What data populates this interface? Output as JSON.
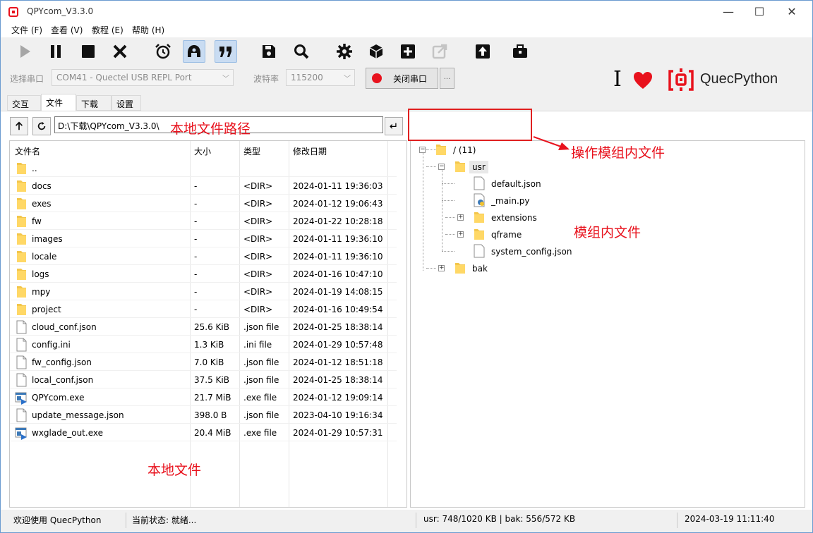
{
  "window": {
    "title": "QPYcom_V3.3.0"
  },
  "menu": [
    "文件 (F)",
    "查看 (V)",
    "教程 (E)",
    "帮助 (H)"
  ],
  "toolbar": {
    "icons": [
      "play-icon",
      "pause-icon",
      "stop-icon",
      "close-x-icon",
      "alarm-clock-icon",
      "rocket-icon",
      "quote-icon",
      "save-icon",
      "search-icon",
      "gear-icon",
      "package-icon",
      "plus-box-icon",
      "export-icon",
      "upload-icon",
      "toolbox-icon"
    ]
  },
  "port": {
    "label": "选择串口",
    "value": "COM41 - Quectel USB REPL Port",
    "baud_label": "波特率",
    "baud_value": "115200",
    "close_label": "关闭串口",
    "more": "..."
  },
  "brand": {
    "name": "QuecPython",
    "cursor": "I"
  },
  "tabs": [
    "交互",
    "文件",
    "下载",
    "设置"
  ],
  "selected_tab": "文件",
  "local": {
    "path": "D:\\下载\\QPYcom_V3.3.0\\",
    "enter": "↵",
    "headers": [
      "文件名",
      "大小",
      "类型",
      "修改日期"
    ],
    "rows": [
      {
        "name": "..",
        "size": "",
        "type": "",
        "date": "",
        "kind": "folder"
      },
      {
        "name": "docs",
        "size": "-",
        "type": "<DIR>",
        "date": "2024-01-11 19:36:03",
        "kind": "folder"
      },
      {
        "name": "exes",
        "size": "-",
        "type": "<DIR>",
        "date": "2024-01-12 19:06:43",
        "kind": "folder"
      },
      {
        "name": "fw",
        "size": "-",
        "type": "<DIR>",
        "date": "2024-01-22 10:28:18",
        "kind": "folder"
      },
      {
        "name": "images",
        "size": "-",
        "type": "<DIR>",
        "date": "2024-01-11 19:36:10",
        "kind": "folder"
      },
      {
        "name": "locale",
        "size": "-",
        "type": "<DIR>",
        "date": "2024-01-11 19:36:10",
        "kind": "folder"
      },
      {
        "name": "logs",
        "size": "-",
        "type": "<DIR>",
        "date": "2024-01-16 10:47:10",
        "kind": "folder"
      },
      {
        "name": "mpy",
        "size": "-",
        "type": "<DIR>",
        "date": "2024-01-19 14:08:15",
        "kind": "folder"
      },
      {
        "name": "project",
        "size": "-",
        "type": "<DIR>",
        "date": "2024-01-16 10:49:54",
        "kind": "folder"
      },
      {
        "name": "cloud_conf.json",
        "size": "25.6 KiB",
        "type": ".json file",
        "date": "2024-01-25 18:38:14",
        "kind": "file"
      },
      {
        "name": "config.ini",
        "size": "1.3 KiB",
        "type": ".ini file",
        "date": "2024-01-29 10:57:48",
        "kind": "file"
      },
      {
        "name": "fw_config.json",
        "size": "7.0 KiB",
        "type": ".json file",
        "date": "2024-01-12 18:51:18",
        "kind": "file"
      },
      {
        "name": "local_conf.json",
        "size": "37.5 KiB",
        "type": ".json file",
        "date": "2024-01-25 18:38:14",
        "kind": "file"
      },
      {
        "name": "QPYcom.exe",
        "size": "21.7 MiB",
        "type": ".exe file",
        "date": "2024-01-12 19:09:14",
        "kind": "exe"
      },
      {
        "name": "update_message.json",
        "size": "398.0 B",
        "type": ".json file",
        "date": "2023-04-10 19:16:34",
        "kind": "file"
      },
      {
        "name": "wxglade_out.exe",
        "size": "20.4 MiB",
        "type": ".exe file",
        "date": "2024-01-29 10:57:31",
        "kind": "exe"
      }
    ]
  },
  "module": {
    "root": "/ (11)",
    "nodes": [
      {
        "name": "usr"
      },
      {
        "name": "default.json"
      },
      {
        "name": "_main.py"
      },
      {
        "name": "extensions"
      },
      {
        "name": "qframe"
      },
      {
        "name": "system_config.json"
      },
      {
        "name": "bak"
      }
    ]
  },
  "annotations": {
    "local_path": "本地文件路径",
    "operate": "操作模组内文件",
    "module_files": "模组内文件",
    "local_files": "本地文件"
  },
  "status": {
    "welcome": "欢迎使用 QuecPython",
    "state": "当前状态: 就绪...",
    "storage": "usr: 748/1020 KB | bak: 556/572 KB",
    "time": "2024-03-19 11:11:40"
  },
  "colors": {
    "accent_red": "#e8121d",
    "tab_active_bg": "#c9dcf2",
    "folder": "#f3c64b"
  }
}
